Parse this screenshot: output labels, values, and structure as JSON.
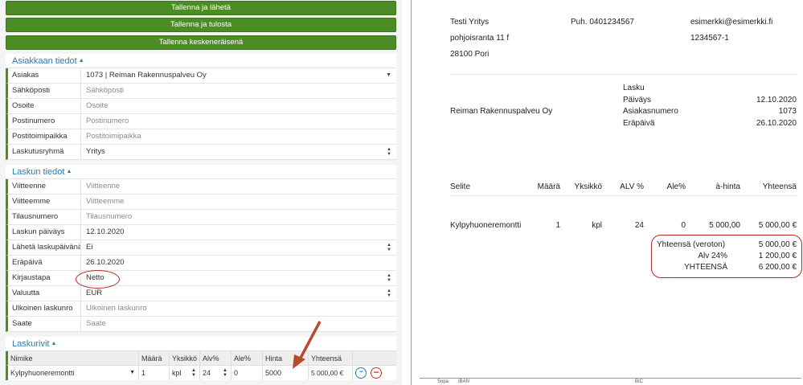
{
  "actions": {
    "save_send": "Tallenna ja lähetä",
    "save_print": "Tallenna ja tulosta",
    "save_draft": "Tallenna keskeneräisenä"
  },
  "customer_section": {
    "title": "Asiakkaan tiedot",
    "fields": [
      {
        "label": "Asiakas",
        "value": "1073 | Reiman Rakennuspalveu Oy",
        "placeholder": false
      },
      {
        "label": "Sähköposti",
        "value": "Sähköposti",
        "placeholder": true
      },
      {
        "label": "Osoite",
        "value": "Osoite",
        "placeholder": true
      },
      {
        "label": "Postinumero",
        "value": "Postinumero",
        "placeholder": true
      },
      {
        "label": "Postitoimipaikka",
        "value": "Postitoimipaikka",
        "placeholder": true
      },
      {
        "label": "Laskutusryhmä",
        "value": "Yritys",
        "placeholder": false
      }
    ]
  },
  "invoice_section": {
    "title": "Laskun tiedot",
    "fields": [
      {
        "label": "Viitteenne",
        "value": "Viitteenne",
        "placeholder": true
      },
      {
        "label": "Viitteemme",
        "value": "Viitteemme",
        "placeholder": true
      },
      {
        "label": "Tilausnumero",
        "value": "Tilausnumero",
        "placeholder": true
      },
      {
        "label": "Laskun päiväys",
        "value": "12.10.2020",
        "placeholder": false
      },
      {
        "label": "Lähetä laskupäivänä",
        "value": "Ei",
        "placeholder": false
      },
      {
        "label": "Eräpäivä",
        "value": "26.10.2020",
        "placeholder": false
      },
      {
        "label": "Kirjaustapa",
        "value": "Netto",
        "placeholder": false
      },
      {
        "label": "Valuutta",
        "value": "EUR",
        "placeholder": false
      },
      {
        "label": "Ulkoinen laskunro",
        "value": "Ulkoinen laskunro",
        "placeholder": true
      },
      {
        "label": "Saate",
        "value": "Saate",
        "placeholder": true
      }
    ]
  },
  "lines_section": {
    "title": "Laskurivit",
    "headers": [
      "Nimike",
      "Määrä",
      "Yksikkö",
      "Alv%",
      "Ale%",
      "Hinta",
      "Yhteensä"
    ],
    "row": {
      "item": "Kylpyhuoneremontti",
      "qty": "1",
      "unit": "kpl",
      "vat": "24",
      "discount": "0",
      "price": "5000",
      "total": "5 000,00 €"
    },
    "more_glyph": "•••",
    "remove_glyph": "−"
  },
  "preview": {
    "sender": {
      "name": "Testi Yritys",
      "street": "pohjoisranta 11 f",
      "city": "28100 Pori",
      "phone": "Puh. 0401234567",
      "email": "esimerkki@esimerkki.fi",
      "business_id": "1234567-1"
    },
    "recipient": "Reiman Rakennuspalveu Oy",
    "doc_title": "Lasku",
    "meta": [
      {
        "label": "Päiväys",
        "value": "12.10.2020"
      },
      {
        "label": "Asiakasnumero",
        "value": "1073"
      },
      {
        "label": "Eräpäivä",
        "value": "26.10.2020"
      }
    ],
    "table_headers": [
      "Selite",
      "Määrä",
      "Yksikkö",
      "ALV %",
      "Ale%",
      "à-hinta",
      "Yhteensä"
    ],
    "table_row": [
      "Kylpyhuoneremontti",
      "1",
      "kpl",
      "24",
      "0",
      "5 000,00",
      "5 000,00 €"
    ],
    "totals": [
      {
        "label": "Yhteensä (veroton)",
        "value": "5 000,00 €"
      },
      {
        "label": "Alv 24%",
        "value": "1 200,00 €"
      },
      {
        "label": "YHTEENSÄ",
        "value": "6 200,00 €"
      }
    ],
    "footer": [
      "Sopa",
      "IBAN",
      "BIC"
    ]
  },
  "colors": {
    "accent_green": "#4c8c25",
    "link_blue": "#2a7ab0",
    "annotation_red": "#b02a2a"
  }
}
